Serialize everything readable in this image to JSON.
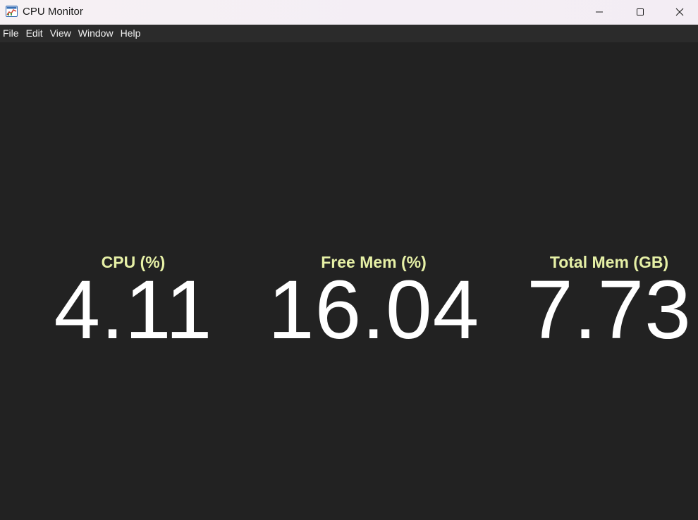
{
  "window": {
    "title": "CPU Monitor",
    "icon": "app-chart-icon",
    "controls": {
      "minimize": "minimize-icon",
      "maximize": "maximize-icon",
      "close": "close-icon"
    }
  },
  "menu": {
    "items": [
      {
        "label": "File"
      },
      {
        "label": "Edit"
      },
      {
        "label": "View"
      },
      {
        "label": "Window"
      },
      {
        "label": "Help"
      }
    ]
  },
  "metrics": {
    "cpu": {
      "label": "CPU (%)",
      "value": "4.11"
    },
    "free_mem": {
      "label": "Free Mem (%)",
      "value": "16.04"
    },
    "total_mem": {
      "label": "Total Mem (GB)",
      "value": "7.73"
    }
  },
  "colors": {
    "background": "#222222",
    "menubar": "#2b2b2b",
    "label_accent": "#e6f0a6",
    "value_text": "#ffffff"
  }
}
